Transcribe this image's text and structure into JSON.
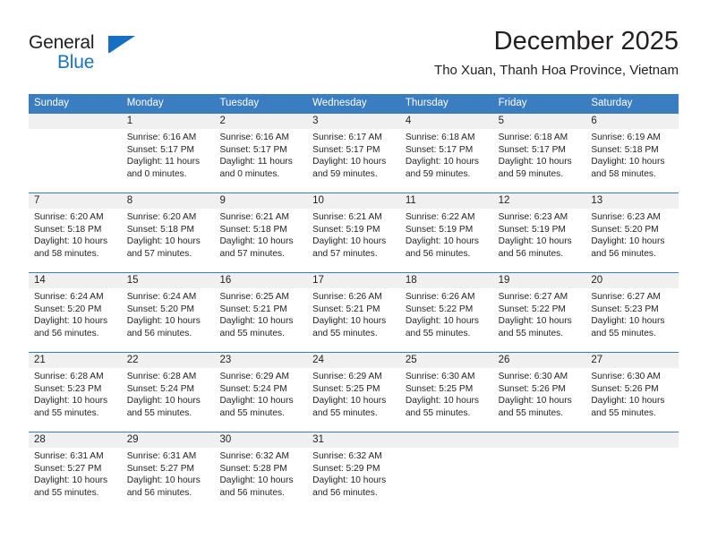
{
  "brand": {
    "name_part1": "General",
    "name_part2": "Blue"
  },
  "header": {
    "title": "December 2025",
    "subtitle": "Tho Xuan, Thanh Hoa Province, Vietnam"
  },
  "colors": {
    "header_blue": "#3a7dc0",
    "day_band_gray": "#f0f0f0",
    "text": "#231f20",
    "logo_blue": "#1b75bb"
  },
  "weekdays": [
    "Sunday",
    "Monday",
    "Tuesday",
    "Wednesday",
    "Thursday",
    "Friday",
    "Saturday"
  ],
  "weeks": [
    [
      {
        "day": "",
        "sunrise": "",
        "sunset": "",
        "daylight1": "",
        "daylight2": ""
      },
      {
        "day": "1",
        "sunrise": "Sunrise: 6:16 AM",
        "sunset": "Sunset: 5:17 PM",
        "daylight1": "Daylight: 11 hours",
        "daylight2": "and 0 minutes."
      },
      {
        "day": "2",
        "sunrise": "Sunrise: 6:16 AM",
        "sunset": "Sunset: 5:17 PM",
        "daylight1": "Daylight: 11 hours",
        "daylight2": "and 0 minutes."
      },
      {
        "day": "3",
        "sunrise": "Sunrise: 6:17 AM",
        "sunset": "Sunset: 5:17 PM",
        "daylight1": "Daylight: 10 hours",
        "daylight2": "and 59 minutes."
      },
      {
        "day": "4",
        "sunrise": "Sunrise: 6:18 AM",
        "sunset": "Sunset: 5:17 PM",
        "daylight1": "Daylight: 10 hours",
        "daylight2": "and 59 minutes."
      },
      {
        "day": "5",
        "sunrise": "Sunrise: 6:18 AM",
        "sunset": "Sunset: 5:17 PM",
        "daylight1": "Daylight: 10 hours",
        "daylight2": "and 59 minutes."
      },
      {
        "day": "6",
        "sunrise": "Sunrise: 6:19 AM",
        "sunset": "Sunset: 5:18 PM",
        "daylight1": "Daylight: 10 hours",
        "daylight2": "and 58 minutes."
      }
    ],
    [
      {
        "day": "7",
        "sunrise": "Sunrise: 6:20 AM",
        "sunset": "Sunset: 5:18 PM",
        "daylight1": "Daylight: 10 hours",
        "daylight2": "and 58 minutes."
      },
      {
        "day": "8",
        "sunrise": "Sunrise: 6:20 AM",
        "sunset": "Sunset: 5:18 PM",
        "daylight1": "Daylight: 10 hours",
        "daylight2": "and 57 minutes."
      },
      {
        "day": "9",
        "sunrise": "Sunrise: 6:21 AM",
        "sunset": "Sunset: 5:18 PM",
        "daylight1": "Daylight: 10 hours",
        "daylight2": "and 57 minutes."
      },
      {
        "day": "10",
        "sunrise": "Sunrise: 6:21 AM",
        "sunset": "Sunset: 5:19 PM",
        "daylight1": "Daylight: 10 hours",
        "daylight2": "and 57 minutes."
      },
      {
        "day": "11",
        "sunrise": "Sunrise: 6:22 AM",
        "sunset": "Sunset: 5:19 PM",
        "daylight1": "Daylight: 10 hours",
        "daylight2": "and 56 minutes."
      },
      {
        "day": "12",
        "sunrise": "Sunrise: 6:23 AM",
        "sunset": "Sunset: 5:19 PM",
        "daylight1": "Daylight: 10 hours",
        "daylight2": "and 56 minutes."
      },
      {
        "day": "13",
        "sunrise": "Sunrise: 6:23 AM",
        "sunset": "Sunset: 5:20 PM",
        "daylight1": "Daylight: 10 hours",
        "daylight2": "and 56 minutes."
      }
    ],
    [
      {
        "day": "14",
        "sunrise": "Sunrise: 6:24 AM",
        "sunset": "Sunset: 5:20 PM",
        "daylight1": "Daylight: 10 hours",
        "daylight2": "and 56 minutes."
      },
      {
        "day": "15",
        "sunrise": "Sunrise: 6:24 AM",
        "sunset": "Sunset: 5:20 PM",
        "daylight1": "Daylight: 10 hours",
        "daylight2": "and 56 minutes."
      },
      {
        "day": "16",
        "sunrise": "Sunrise: 6:25 AM",
        "sunset": "Sunset: 5:21 PM",
        "daylight1": "Daylight: 10 hours",
        "daylight2": "and 55 minutes."
      },
      {
        "day": "17",
        "sunrise": "Sunrise: 6:26 AM",
        "sunset": "Sunset: 5:21 PM",
        "daylight1": "Daylight: 10 hours",
        "daylight2": "and 55 minutes."
      },
      {
        "day": "18",
        "sunrise": "Sunrise: 6:26 AM",
        "sunset": "Sunset: 5:22 PM",
        "daylight1": "Daylight: 10 hours",
        "daylight2": "and 55 minutes."
      },
      {
        "day": "19",
        "sunrise": "Sunrise: 6:27 AM",
        "sunset": "Sunset: 5:22 PM",
        "daylight1": "Daylight: 10 hours",
        "daylight2": "and 55 minutes."
      },
      {
        "day": "20",
        "sunrise": "Sunrise: 6:27 AM",
        "sunset": "Sunset: 5:23 PM",
        "daylight1": "Daylight: 10 hours",
        "daylight2": "and 55 minutes."
      }
    ],
    [
      {
        "day": "21",
        "sunrise": "Sunrise: 6:28 AM",
        "sunset": "Sunset: 5:23 PM",
        "daylight1": "Daylight: 10 hours",
        "daylight2": "and 55 minutes."
      },
      {
        "day": "22",
        "sunrise": "Sunrise: 6:28 AM",
        "sunset": "Sunset: 5:24 PM",
        "daylight1": "Daylight: 10 hours",
        "daylight2": "and 55 minutes."
      },
      {
        "day": "23",
        "sunrise": "Sunrise: 6:29 AM",
        "sunset": "Sunset: 5:24 PM",
        "daylight1": "Daylight: 10 hours",
        "daylight2": "and 55 minutes."
      },
      {
        "day": "24",
        "sunrise": "Sunrise: 6:29 AM",
        "sunset": "Sunset: 5:25 PM",
        "daylight1": "Daylight: 10 hours",
        "daylight2": "and 55 minutes."
      },
      {
        "day": "25",
        "sunrise": "Sunrise: 6:30 AM",
        "sunset": "Sunset: 5:25 PM",
        "daylight1": "Daylight: 10 hours",
        "daylight2": "and 55 minutes."
      },
      {
        "day": "26",
        "sunrise": "Sunrise: 6:30 AM",
        "sunset": "Sunset: 5:26 PM",
        "daylight1": "Daylight: 10 hours",
        "daylight2": "and 55 minutes."
      },
      {
        "day": "27",
        "sunrise": "Sunrise: 6:30 AM",
        "sunset": "Sunset: 5:26 PM",
        "daylight1": "Daylight: 10 hours",
        "daylight2": "and 55 minutes."
      }
    ],
    [
      {
        "day": "28",
        "sunrise": "Sunrise: 6:31 AM",
        "sunset": "Sunset: 5:27 PM",
        "daylight1": "Daylight: 10 hours",
        "daylight2": "and 55 minutes."
      },
      {
        "day": "29",
        "sunrise": "Sunrise: 6:31 AM",
        "sunset": "Sunset: 5:27 PM",
        "daylight1": "Daylight: 10 hours",
        "daylight2": "and 56 minutes."
      },
      {
        "day": "30",
        "sunrise": "Sunrise: 6:32 AM",
        "sunset": "Sunset: 5:28 PM",
        "daylight1": "Daylight: 10 hours",
        "daylight2": "and 56 minutes."
      },
      {
        "day": "31",
        "sunrise": "Sunrise: 6:32 AM",
        "sunset": "Sunset: 5:29 PM",
        "daylight1": "Daylight: 10 hours",
        "daylight2": "and 56 minutes."
      },
      {
        "day": "",
        "sunrise": "",
        "sunset": "",
        "daylight1": "",
        "daylight2": ""
      },
      {
        "day": "",
        "sunrise": "",
        "sunset": "",
        "daylight1": "",
        "daylight2": ""
      },
      {
        "day": "",
        "sunrise": "",
        "sunset": "",
        "daylight1": "",
        "daylight2": ""
      }
    ]
  ]
}
